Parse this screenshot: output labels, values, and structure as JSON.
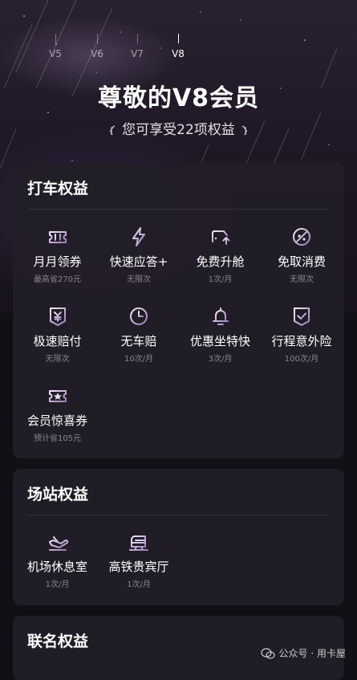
{
  "levels": [
    {
      "label": "V5",
      "active": false
    },
    {
      "label": "V6",
      "active": false
    },
    {
      "label": "V7",
      "active": false
    },
    {
      "label": "V8",
      "active": true
    }
  ],
  "hero": {
    "title": "尊敬的V8会员",
    "subtitle": "您可享受22项权益"
  },
  "sections": [
    {
      "title": "打车权益",
      "items": [
        {
          "icon": "ticket-icon",
          "label": "月月领券",
          "sub": "最高省270元"
        },
        {
          "icon": "lightning-icon",
          "label": "快速应答+",
          "sub": "无限次"
        },
        {
          "icon": "car-upgrade-icon",
          "label": "免费升舱",
          "sub": "1次/月"
        },
        {
          "icon": "no-fee-icon",
          "label": "免取消费",
          "sub": "无限次"
        },
        {
          "icon": "yuan-shield-icon",
          "label": "极速赔付",
          "sub": "无限次"
        },
        {
          "icon": "clock-icon",
          "label": "无车赔",
          "sub": "10次/月"
        },
        {
          "icon": "bell-icon",
          "label": "优惠坐特快",
          "sub": "3次/月"
        },
        {
          "icon": "check-shield-icon",
          "label": "行程意外险",
          "sub": "100次/月"
        },
        {
          "icon": "star-ticket-icon",
          "label": "会员惊喜券",
          "sub": "预计省105元"
        }
      ]
    },
    {
      "title": "场站权益",
      "items": [
        {
          "icon": "airplane-icon",
          "label": "机场休息室",
          "sub": "1次/月"
        },
        {
          "icon": "train-icon",
          "label": "高铁贵宾厅",
          "sub": "1次/月"
        }
      ]
    },
    {
      "title": "联名权益",
      "items": []
    }
  ],
  "watermark": "公众号 · 用卡屋",
  "colors": {
    "background": "#121016",
    "card": "#221e28",
    "accent_light": "#e9d9f4",
    "accent_dark": "#8a6aa6"
  }
}
